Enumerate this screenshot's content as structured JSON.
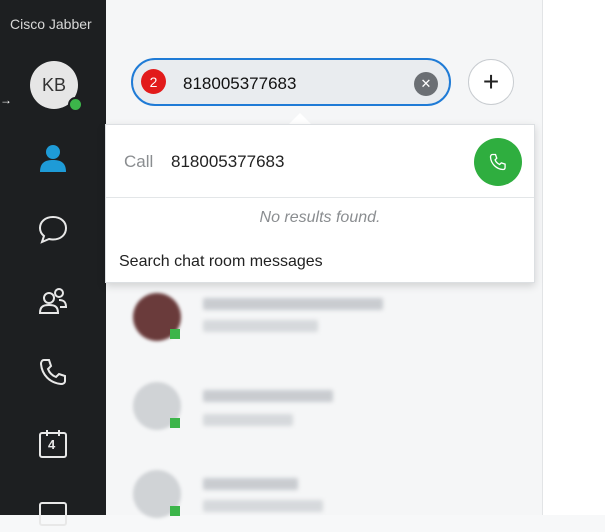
{
  "app": {
    "title": "Cisco Jabber"
  },
  "user": {
    "initials": "KB",
    "presence_color": "#3cb54a"
  },
  "nav": [
    {
      "name": "contacts",
      "icon": "person-icon",
      "active": true
    },
    {
      "name": "chats",
      "icon": "chat-bubble-icon"
    },
    {
      "name": "groups",
      "icon": "people-icon"
    },
    {
      "name": "calls",
      "icon": "phone-icon"
    },
    {
      "name": "calendar",
      "icon": "calendar-icon",
      "badge": "4"
    },
    {
      "name": "voicemail",
      "icon": "voicemail-icon"
    }
  ],
  "search": {
    "value": "818005377683",
    "step_badge": "2"
  },
  "dropdown": {
    "call_label": "Call",
    "call_number": "818005377683",
    "no_results": "No results found.",
    "search_chat": "Search chat room messages"
  },
  "colors": {
    "accent": "#1f7bd6",
    "call_green": "#2fae3f",
    "badge_red": "#e21b1b",
    "sidebar": "#1d1f21"
  }
}
